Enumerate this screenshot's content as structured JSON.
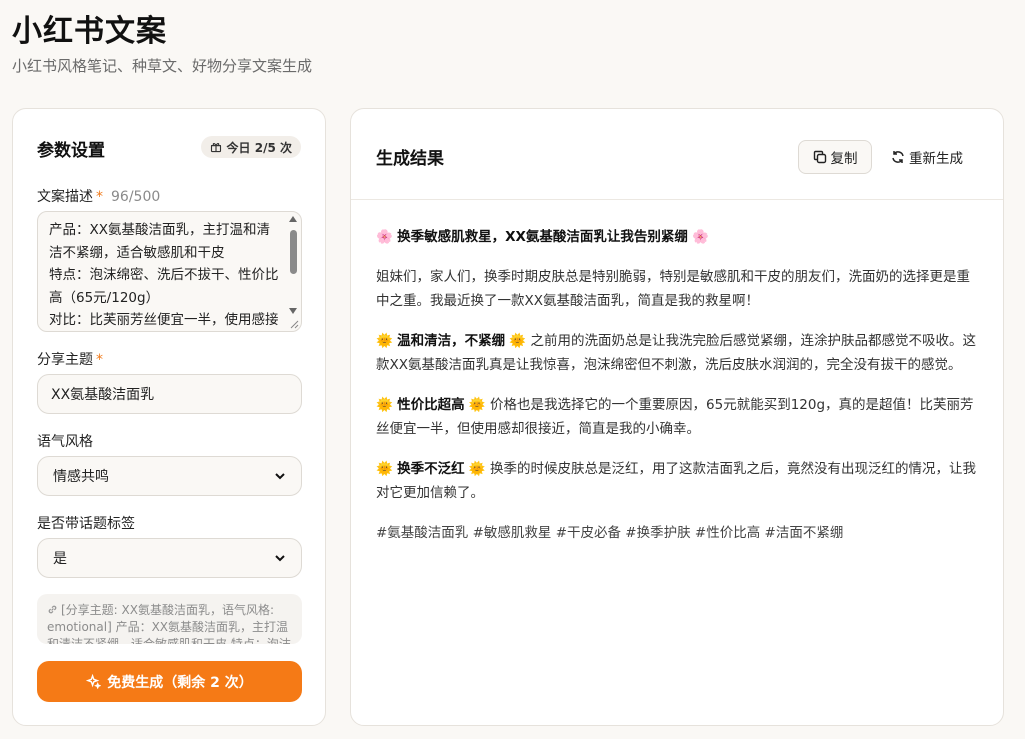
{
  "header": {
    "title": "小红书文案",
    "subtitle": "小红书风格笔记、种草文、好物分享文案生成"
  },
  "params": {
    "title": "参数设置",
    "quota": "今日 2/5 次",
    "desc_label": "文案描述",
    "required_mark": "*",
    "desc_counter": "96/500",
    "desc_value": "产品：XX氨基酸洁面乳，主打温和清洁不紧绷，适合敏感肌和干皮\n特点：泡沫绵密、洗后不拔干、性价比高（65元/120g）\n对比：比芙丽芳丝便宜一半，使用感接近",
    "topic_label": "分享主题",
    "topic_value": "XX氨基酸洁面乳",
    "tone_label": "语气风格",
    "tone_value": "情感共鸣",
    "hashtag_label": "是否带话题标签",
    "hashtag_value": "是",
    "prompt_preview": "[分享主题: XX氨基酸洁面乳，语气风格: emotional] 产品：XX氨基酸洁面乳，主打温和清洁不紧绷，适合敏感肌和干皮 特点：泡沫",
    "generate_label": "免费生成（剩余 2 次）"
  },
  "result": {
    "title": "生成结果",
    "copy_label": "复制",
    "regen_label": "重新生成",
    "headline": "换季敏感肌救星，XX氨基酸洁面乳让我告别紧绷",
    "intro": "姐妹们，家人们，换季时期皮肤总是特别脆弱，特别是敏感肌和干皮的朋友们，洗面奶的选择更是重中之重。我最近换了一款XX氨基酸洁面乳，简直是我的救星啊！",
    "s1_title": "温和清洁，不紧绷",
    "s1_body": "之前用的洗面奶总是让我洗完脸后感觉紧绷，连涂护肤品都感觉不吸收。这款XX氨基酸洁面乳真是让我惊喜，泡沫绵密但不刺激，洗后皮肤水润润的，完全没有拔干的感觉。",
    "s2_title": "性价比超高",
    "s2_body": "价格也是我选择它的一个重要原因，65元就能买到120g，真的是超值！比芙丽芳丝便宜一半，但使用感却很接近，简直是我的小确幸。",
    "s3_title": "换季不泛红",
    "s3_body": "换季的时候皮肤总是泛红，用了这款洁面乳之后，竟然没有出现泛红的情况，让我对它更加信赖了。",
    "hashtags": "#氨基酸洁面乳 #敏感肌救星 #干皮必备 #换季护肤 #性价比高 #洁面不紧绷",
    "emoji_flower": "🌸",
    "emoji_sun": "🌞"
  }
}
